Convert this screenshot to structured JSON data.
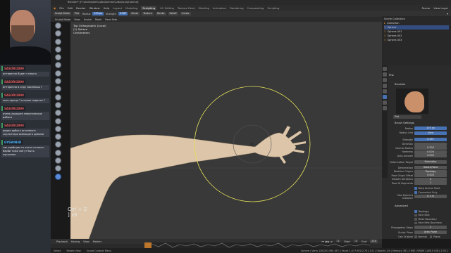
{
  "overlay": {
    "chat": [
      {
        "user": "SASORI2890",
        "text": "интересно будет глянуть"
      },
      {
        "user": "SASORI2890",
        "text": "интересно в игру закинешь ?"
      },
      {
        "user": "SASORI2890",
        "text": "зато проще ? в каких задачах ?"
      },
      {
        "user": "SASORI2890",
        "text": "очень хорошее энергическое работа"
      },
      {
        "user": "SASORI2890",
        "text": "видел работу истинного скульптора имеющего домики"
      },
      {
        "user": "GYSWIN3D",
        "text": "так вообщем то хотел сказать - барби тоже могут быть мусулмон"
      }
    ],
    "keystroke": {
      "line1": "Ctrl + Z",
      "line2": "] x8"
    }
  },
  "window": {
    "title": "Blender* [F:\\Vanilla\\Dell\\Labs\\Demon\\Labs\\sculpt.blend]"
  },
  "menu": {
    "items": [
      "File",
      "Edit",
      "Render",
      "Window",
      "Help"
    ],
    "workspaces": [
      "Layout",
      "Modeling",
      "Sculpting",
      "UV Editing",
      "Texture Paint",
      "Shading",
      "Animation",
      "Rendering",
      "Compositing",
      "Scripting"
    ],
    "active_workspace": "Sculpting",
    "scene": "Scene",
    "view_layer": "View Layer"
  },
  "tool_header": {
    "mode": "Sculpt Mode",
    "brush": "Plst",
    "radius_label": "Radius",
    "radius_value": "105 px",
    "strength_label": "Strength",
    "strength_value": "0.587",
    "menus": [
      "Brush",
      "Texture",
      "Stroke",
      "Falloff",
      "Cursor"
    ]
  },
  "viewport_header": {
    "items": [
      "Sculpt Mode",
      "View",
      "Sculpt",
      "Mask",
      "Face Sets"
    ]
  },
  "viewport": {
    "info_line1": "Top Orthographic (Local)",
    "info_line2": "(1) Sphere",
    "info_line3": "Centimeters"
  },
  "outliner": {
    "title": "Scene Collection",
    "rows": [
      {
        "name": "Collection",
        "selected": false
      },
      {
        "name": "Sphere",
        "selected": true
      },
      {
        "name": "Sphere.001",
        "selected": false
      },
      {
        "name": "Sphere.002",
        "selected": false
      },
      {
        "name": "Sphere.003",
        "selected": false
      }
    ]
  },
  "properties": {
    "brush_name": "Plst",
    "sections": {
      "brushes": "Brushes",
      "brush_settings": "Brush Settings",
      "advanced": "Advanced"
    },
    "rows": [
      {
        "label": "Radius",
        "value": "105 px",
        "highlight": true
      },
      {
        "label": "Radius Unit",
        "value": "View",
        "highlight": true
      },
      {
        "label": "Strength",
        "value": "0.587",
        "highlight": true
      },
      {
        "label": "Direction",
        "value": "",
        "highlight": false
      },
      {
        "label": "Normal Radius",
        "value": "0.500",
        "highlight": false
      },
      {
        "label": "Hardness",
        "value": "0.000",
        "highlight": false
      },
      {
        "label": "Auto-Smooth",
        "value": "0.000",
        "highlight": false
      },
      {
        "label": "Deformation Target",
        "value": "Geometry",
        "highlight": false
      },
      {
        "label": "Deformation",
        "value": "Rotate/Twist",
        "highlight": false
      },
      {
        "label": "Rotation Origins",
        "value": "Topology",
        "highlight": false
      },
      {
        "label": "Pose Origin Offset",
        "value": "0.000",
        "highlight": false
      },
      {
        "label": "Smooth Iterations",
        "value": "4",
        "highlight": false
      },
      {
        "label": "Pose IK Segments",
        "value": "1",
        "highlight": false
      }
    ],
    "checks": [
      {
        "label": "Keep Anchor Point",
        "on": true
      },
      {
        "label": "Connected Only",
        "on": true
      }
    ],
    "max_element": {
      "label": "Max Element Distance",
      "value": "0.1 m"
    },
    "advanced_checks": [
      {
        "label": "Topology",
        "on": true
      },
      {
        "label": "Face Sets",
        "on": false
      },
      {
        "label": "Mesh Boundary",
        "on": false
      },
      {
        "label": "Face Sets Boundary",
        "on": false
      }
    ],
    "propagation": {
      "label": "Propagation Steps",
      "value": "1"
    },
    "sculpt_plane": {
      "label": "Sculpt Plane",
      "value": "Area Plane"
    },
    "use_original": {
      "label": "Use Original",
      "items": [
        "Normal",
        "Plane"
      ]
    }
  },
  "timeline": {
    "items": [
      "Playback",
      "Keying",
      "View",
      "Marker"
    ],
    "frame": "1",
    "start_label": "Start",
    "start": "1",
    "end_label": "End",
    "end": "250"
  },
  "status": {
    "left": [
      "Select",
      "Rotate View",
      "Sculpt Context Menu"
    ],
    "right": "Sphere | Verts 136,007,564 (87) | Faces 1,477,952/2,751,131 | Objects 1/4 | Memory 381.3 MiB | VRAM 1.8/8.0 GiB | 2.93.1"
  },
  "colors": {
    "accent": "#4772b3",
    "viewport_bg": "#393939",
    "brush_circle": "#e4e15a",
    "mesh": "#dcc5a8",
    "chat_user_red": "#e05a5a",
    "chat_user_blue": "#4db6ff"
  },
  "icons": [
    "webcam-feed",
    "tool-icons",
    "brush-preview",
    "chat-badge-icon"
  ]
}
